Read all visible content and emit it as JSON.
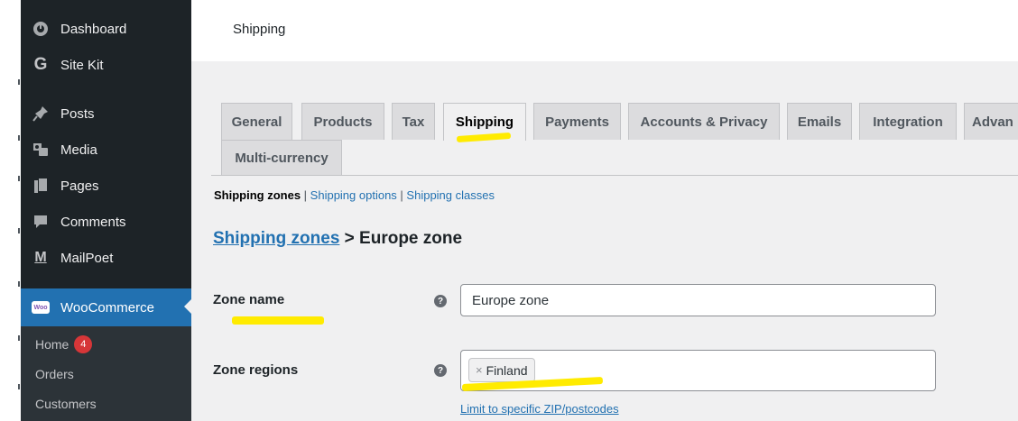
{
  "sidebar": {
    "items": [
      {
        "label": "Dashboard",
        "icon": "dashboard-icon"
      },
      {
        "label": "Site Kit",
        "icon": "site-kit-g-icon"
      },
      {
        "label": "Posts",
        "icon": "pin-icon"
      },
      {
        "label": "Media",
        "icon": "media-icon"
      },
      {
        "label": "Pages",
        "icon": "pages-icon"
      },
      {
        "label": "Comments",
        "icon": "comments-icon"
      },
      {
        "label": "MailPoet",
        "icon": "mailpoet-icon"
      },
      {
        "label": "WooCommerce",
        "icon": "woo-icon",
        "badge_text": "Woo"
      }
    ],
    "submenu": [
      {
        "label": "Home",
        "count": "4"
      },
      {
        "label": "Orders"
      },
      {
        "label": "Customers"
      }
    ]
  },
  "header": {
    "title": "Shipping"
  },
  "tabs": [
    {
      "label": "General"
    },
    {
      "label": "Products"
    },
    {
      "label": "Tax"
    },
    {
      "label": "Shipping",
      "active": true
    },
    {
      "label": "Payments"
    },
    {
      "label": "Accounts & Privacy"
    },
    {
      "label": "Emails"
    },
    {
      "label": "Integration"
    },
    {
      "label": "Advan"
    },
    {
      "label": "Multi-currency"
    }
  ],
  "subnav": {
    "current": "Shipping zones",
    "sep1": " | ",
    "link1": "Shipping options",
    "sep2": " | ",
    "link2": "Shipping classes"
  },
  "breadcrumb": {
    "link": "Shipping zones",
    "separator": " > ",
    "current": "Europe zone"
  },
  "form": {
    "zone_name_label": "Zone name",
    "zone_name_value": "Europe zone",
    "zone_regions_label": "Zone regions",
    "region_token": "Finland",
    "token_remove": "×",
    "help_glyph": "?",
    "limit_link": "Limit to specific ZIP/postcodes"
  },
  "colors": {
    "sidebar_bg": "#1d2327",
    "accent": "#2271b1",
    "highlight": "#ffeb00"
  }
}
